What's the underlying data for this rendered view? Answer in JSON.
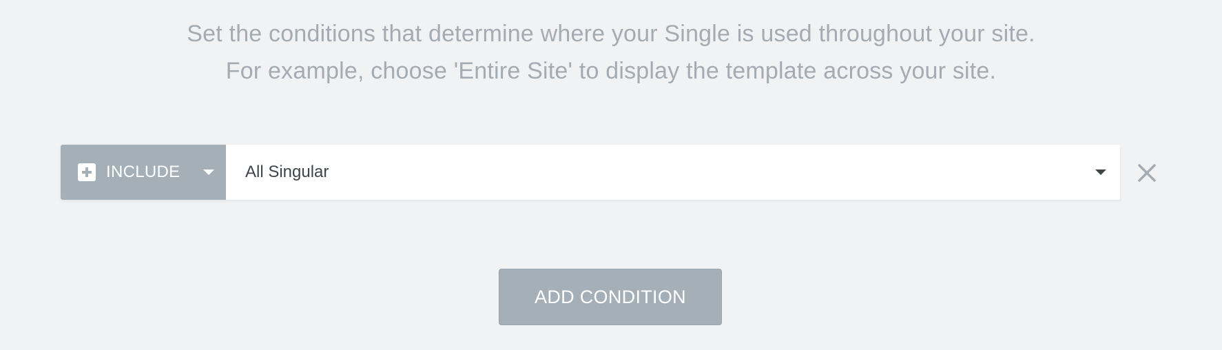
{
  "intro": {
    "line1": "Set the conditions that determine where your Single is used throughout your site.",
    "line2": "For example, choose 'Entire Site' to display the template across your site."
  },
  "condition": {
    "type_icon": "plus-square-icon",
    "type_label": "INCLUDE",
    "value_label": "All Singular",
    "remove_icon": "close-icon"
  },
  "add_button": {
    "label": "ADD CONDITION"
  },
  "colors": {
    "background": "#f1f2f4",
    "muted_text": "#a4abb3",
    "accent_gray": "#a4afb7",
    "dark_text": "#3f444b"
  }
}
